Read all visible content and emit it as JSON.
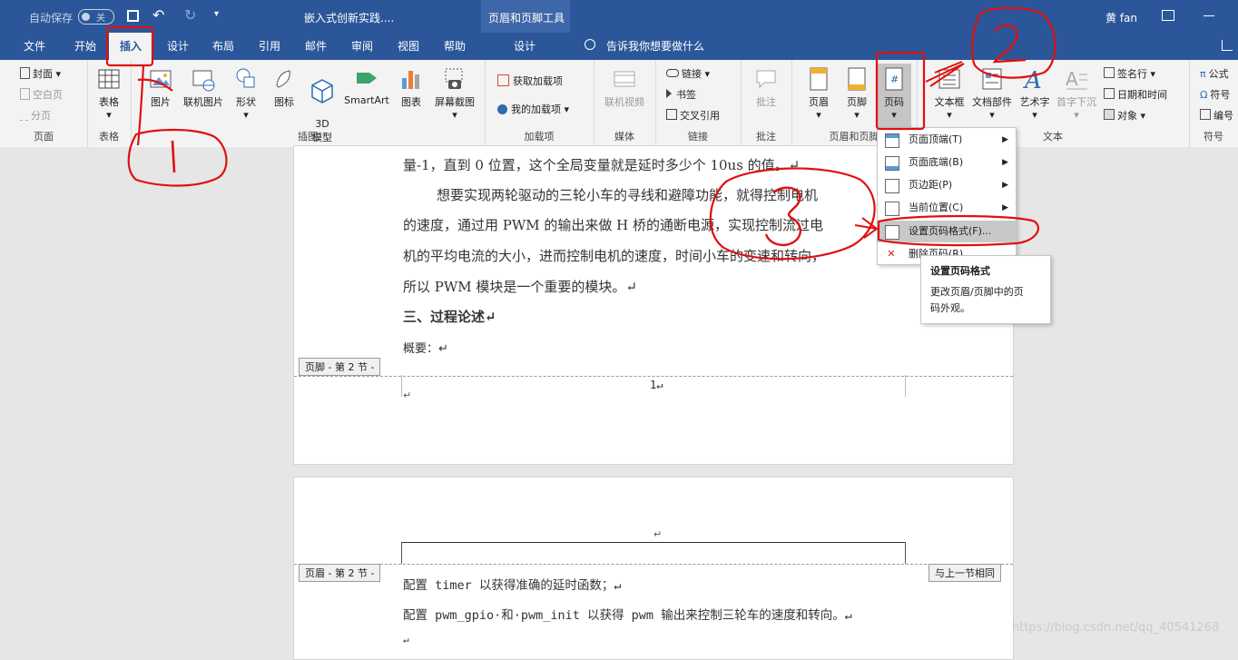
{
  "titlebar": {
    "autosave": "自动保存",
    "autosave_state": "关",
    "doc_title": "嵌入式创新实践....",
    "context_tool": "页眉和页脚工具",
    "user": "黄 fan"
  },
  "tabs": [
    "文件",
    "开始",
    "插入",
    "设计",
    "布局",
    "引用",
    "邮件",
    "审阅",
    "视图",
    "帮助"
  ],
  "context_tab": "设计",
  "tell_me": "告诉我你想要做什么",
  "ribbon": {
    "pages": {
      "items": [
        "封面",
        "空白页",
        "分页"
      ],
      "label": "页面"
    },
    "tables": {
      "item": "表格",
      "label": "表格"
    },
    "illustrations": {
      "items": [
        "图片",
        "联机图片",
        "形状",
        "图标",
        "3D\n模型",
        "SmartArt",
        "图表",
        "屏幕截图"
      ],
      "label": "插图"
    },
    "addins": {
      "items": [
        "获取加载项",
        "我的加载项"
      ],
      "label": "加载项"
    },
    "media": {
      "item": "联机视频",
      "label": "媒体"
    },
    "links": {
      "items": [
        "链接",
        "书签",
        "交叉引用"
      ],
      "label": "链接"
    },
    "comments": {
      "item": "批注",
      "label": "批注"
    },
    "header_footer": {
      "items": [
        "页眉",
        "页脚",
        "页码"
      ],
      "label": "页眉和页脚"
    },
    "text": {
      "items": [
        "文本框",
        "文档部件",
        "艺术字",
        "首字下沉",
        "签名行",
        "日期和时间",
        "对象"
      ],
      "label": "文本"
    },
    "symbols": {
      "items": [
        "公式",
        "符号",
        "编号"
      ],
      "label": "符号"
    }
  },
  "document": {
    "page1_lines": [
      "量-1，直到 0 位置，这个全局变量就是延时多少个 10us 的值。↵",
      "想要实现两轮驱动的三轮小车的寻线和避障功能，就得控制电机",
      "的速度，通过用 PWM 的输出来做 H 桥的通断电源，实现控制流过电",
      "机的平均电流的大小，进而控制电机的速度，时间小车的变速和转向，",
      "所以 PWM 模块是一个重要的模块。↵",
      "三、过程论述↵",
      "概要：↵"
    ],
    "footer_tag": "页脚 - 第 2 节 -",
    "page_num": "1↵",
    "para_mark": "↵",
    "header_tag": "页眉 - 第 2 节 -",
    "same_as_prev": "与上一节相同",
    "page2_lines": [
      "配置 timer 以获得准确的延时函数；↵",
      "配置 pwm_gpio·和·pwm_init 以获得 pwm 输出来控制三轮车的速度和转向。↵",
      "↵"
    ]
  },
  "menu": {
    "items": [
      "页面顶端(T)",
      "页面底端(B)",
      "页边距(P)",
      "当前位置(C)",
      "设置页码格式(F)...",
      "删除页码(R)"
    ]
  },
  "tooltip": {
    "title": "设置页码格式",
    "body_1": "更改页眉/页脚中的页",
    "body_2": "码外观。"
  },
  "watermark": "https://blog.csdn.net/qq_40541268",
  "colors": {
    "brand": "#2b579a",
    "annotation": "#e01010"
  }
}
